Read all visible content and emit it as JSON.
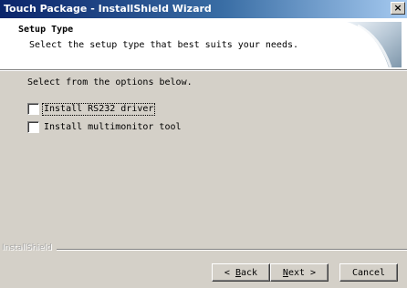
{
  "window": {
    "title": "Touch Package - InstallShield Wizard",
    "close_glyph": "×"
  },
  "header": {
    "title": "Setup Type",
    "subtitle": "Select the setup type that best suits your needs."
  },
  "main": {
    "instruction": "Select from the options below.",
    "options": [
      {
        "label": "Install RS232 driver",
        "checked": false,
        "focused": true
      },
      {
        "label": "Install multimonitor tool",
        "checked": false,
        "focused": false
      }
    ]
  },
  "footer": {
    "brand": "InstallShield",
    "buttons": {
      "back": {
        "prefix": "< ",
        "accel": "B",
        "rest": "ack"
      },
      "next": {
        "accel": "N",
        "rest": "ext >"
      },
      "cancel": "Cancel"
    }
  },
  "colors": {
    "titlebar_start": "#0a246a",
    "titlebar_end": "#a6caf0",
    "face": "#d4d0c8"
  }
}
